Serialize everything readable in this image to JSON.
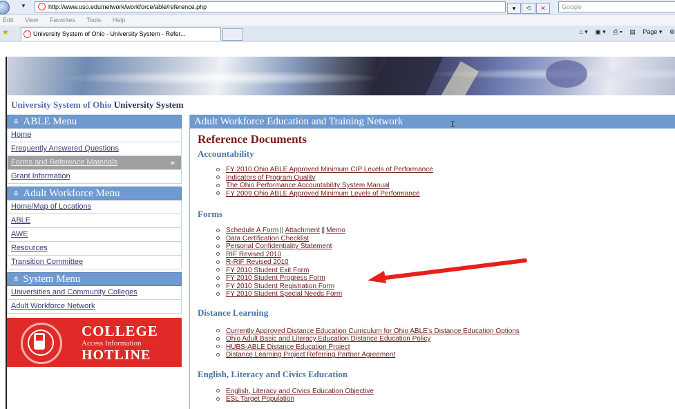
{
  "browser": {
    "url": "http://www.uso.edu/network/workforce/able/reference.php",
    "search_placeholder": "Google",
    "menu": [
      "Edit",
      "View",
      "Favorites",
      "Tools",
      "Help"
    ],
    "tab_title": "University System of Ohio - University System - Refer...",
    "page_menu": "Page"
  },
  "site": {
    "title_part1": "University System of Ohio",
    "title_part2": "University System"
  },
  "sidebar": {
    "able_menu": {
      "title": "ABLE Menu",
      "items": [
        {
          "label": "Home"
        },
        {
          "label": "Frequently Answered Questions"
        },
        {
          "label": "Forms and Reference Materials",
          "active": true
        },
        {
          "label": "Grant Information"
        }
      ]
    },
    "adult_menu": {
      "title": "Adult Workforce Menu",
      "items": [
        {
          "label": "Home/Map of Locations"
        },
        {
          "label": "ABLE"
        },
        {
          "label": "AWE"
        },
        {
          "label": "Resources"
        },
        {
          "label": "Transition Committee"
        }
      ]
    },
    "system_menu": {
      "title": "System Menu",
      "items": [
        {
          "label": "Universities and Community Colleges"
        },
        {
          "label": "Adult Workforce Network"
        }
      ]
    },
    "hotline": {
      "line1": "COLLEGE",
      "line2": "Access Information",
      "line3": "HOTLINE"
    }
  },
  "main": {
    "header": "Adult Workforce Education and Training Network",
    "heading": "Reference Documents",
    "sections": {
      "accountability": {
        "title": "Accountability",
        "items": [
          "FY 2010 Ohio ABLE Approved Minimum CIP Levels of Performance",
          "Indicators of Program Quality",
          "The Ohio Performance Accountability System Manual",
          "FY 2009 Ohio ABLE Approved Minimum Levels of Performance"
        ]
      },
      "forms": {
        "title": "Forms",
        "schedule_a": "Schedule A Form",
        "attachment": "Attachment",
        "memo": "Memo",
        "separator": "||",
        "items": [
          "Data Certification Checklist",
          "Personal Confidentiality Statement",
          "RIF Revised 2010",
          "R-RIF Revised 2010",
          "FY 2010 Student Exit Form",
          "FY 2010 Student Progress Form",
          "FY 2010 Student Registration Form",
          "FY 2010 Student Special Needs Form"
        ]
      },
      "distance": {
        "title": "Distance Learning",
        "items": [
          "Currently Approved Distance Education Curriculum for Ohio ABLE's Distance Education Options",
          "Ohio Adult Basic and Literacy Education Distance Education Policy",
          "HUBS-ABLE Distance Education Project",
          "Distance Learning Project Referring Partner Agreement"
        ]
      },
      "english": {
        "title": "English, Literacy and Civics Education",
        "items": [
          "English, Literacy and Civics Education Objective",
          "ESL Target Population"
        ]
      }
    }
  },
  "colors": {
    "menu_header": "#6f9ad0",
    "heading_red": "#7a1a16",
    "section_blue": "#4a73a9",
    "hotline_red": "#e02a27",
    "arrow_red": "#e8201a"
  }
}
